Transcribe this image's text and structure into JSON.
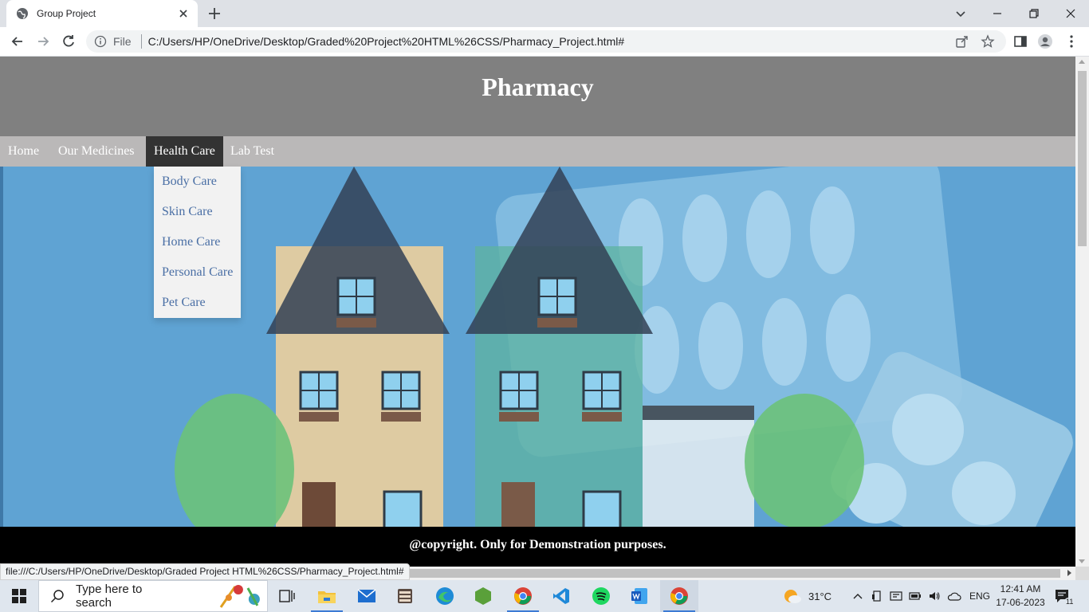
{
  "browser": {
    "tab_title": "Group Project",
    "omnibox_scheme": "File",
    "url": "C:/Users/HP/OneDrive/Desktop/Graded%20Project%20HTML%26CSS/Pharmacy_Project.html#",
    "status_url": "file:///C:/Users/HP/OneDrive/Desktop/Graded Project HTML%26CSS/Pharmacy_Project.html#"
  },
  "site": {
    "title": "Pharmacy",
    "nav": [
      {
        "label": "Home"
      },
      {
        "label": "Our Medicines"
      },
      {
        "label": "Health Care"
      },
      {
        "label": "Lab Test"
      }
    ],
    "dropdown": [
      {
        "label": "Body Care"
      },
      {
        "label": "Skin Care"
      },
      {
        "label": "Home Care"
      },
      {
        "label": "Personal Care"
      },
      {
        "label": "Pet Care"
      }
    ],
    "footer": "@copyright. Only for Demonstration purposes.",
    "colors": {
      "header_bg": "#808080",
      "navbar_bg": "#bab8b8",
      "nav_active_bg": "#333333",
      "dropdown_bg": "#f2f2f2",
      "dropdown_text": "#4a6fa5",
      "footer_bg": "#000000"
    }
  },
  "taskbar": {
    "search_placeholder": "Type here to search",
    "weather": "31°C",
    "language": "ENG",
    "time": "12:41 AM",
    "date": "17-06-2023",
    "notifications": "11",
    "apps": [
      "task-view-icon",
      "file-explorer-icon",
      "mail-icon",
      "library-icon",
      "edge-icon",
      "node-icon",
      "chrome-icon",
      "vscode-icon",
      "spotify-icon",
      "word-icon",
      "chrome-icon"
    ]
  }
}
